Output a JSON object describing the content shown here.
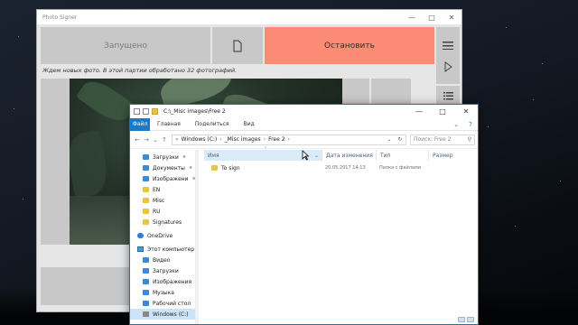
{
  "photo_signer": {
    "title": "Photo Signer",
    "status_label": "Запущено",
    "stop_label": "Остановить",
    "message": "Ждем новых фото. В этой партии обработано 32 фотографий.",
    "icons": [
      "document-icon",
      "menu-icon",
      "play-icon",
      "list-icon"
    ]
  },
  "explorer": {
    "title_path": "C:\\_Misc images\\Free 2",
    "ribbon": {
      "file": "Файл",
      "home": "Главная",
      "share": "Поделиться",
      "view": "Вид"
    },
    "address": [
      "Windows (C:)",
      "_Misc images",
      "Free 2"
    ],
    "search_placeholder": "Поиск: Free 2",
    "columns": {
      "name": "Имя",
      "date": "Дата изменения",
      "type": "Тип",
      "size": "Размер"
    },
    "files": [
      {
        "name": "To sign",
        "date": "20.05.2017 14:13",
        "type": "Папка с файлами",
        "size": ""
      }
    ],
    "nav": {
      "quick": [
        {
          "label": "Загрузки",
          "icon": "downloads-icon",
          "pinned": true
        },
        {
          "label": "Документы",
          "icon": "documents-icon",
          "pinned": true
        },
        {
          "label": "Изображени",
          "icon": "pictures-icon",
          "pinned": true
        },
        {
          "label": "EN",
          "icon": "folder-icon"
        },
        {
          "label": "Misc",
          "icon": "folder-icon"
        },
        {
          "label": "RU",
          "icon": "folder-icon"
        },
        {
          "label": "Signatures",
          "icon": "folder-icon"
        }
      ],
      "onedrive": "OneDrive",
      "this_pc": "Этот компьютер",
      "pc_items": [
        {
          "label": "Видео",
          "icon": "video-icon"
        },
        {
          "label": "Загрузки",
          "icon": "downloads-icon"
        },
        {
          "label": "Изображения",
          "icon": "pictures-icon"
        },
        {
          "label": "Музыка",
          "icon": "music-icon"
        },
        {
          "label": "Рабочий стол",
          "icon": "desktop-icon"
        },
        {
          "label": "Windows (C:)",
          "icon": "drive-icon"
        }
      ]
    }
  },
  "colors": {
    "stop_button": "#fb8b74",
    "panel_gray": "#c8c8c8",
    "explorer_accent": "#1979ca",
    "selection": "#cce4f7"
  }
}
